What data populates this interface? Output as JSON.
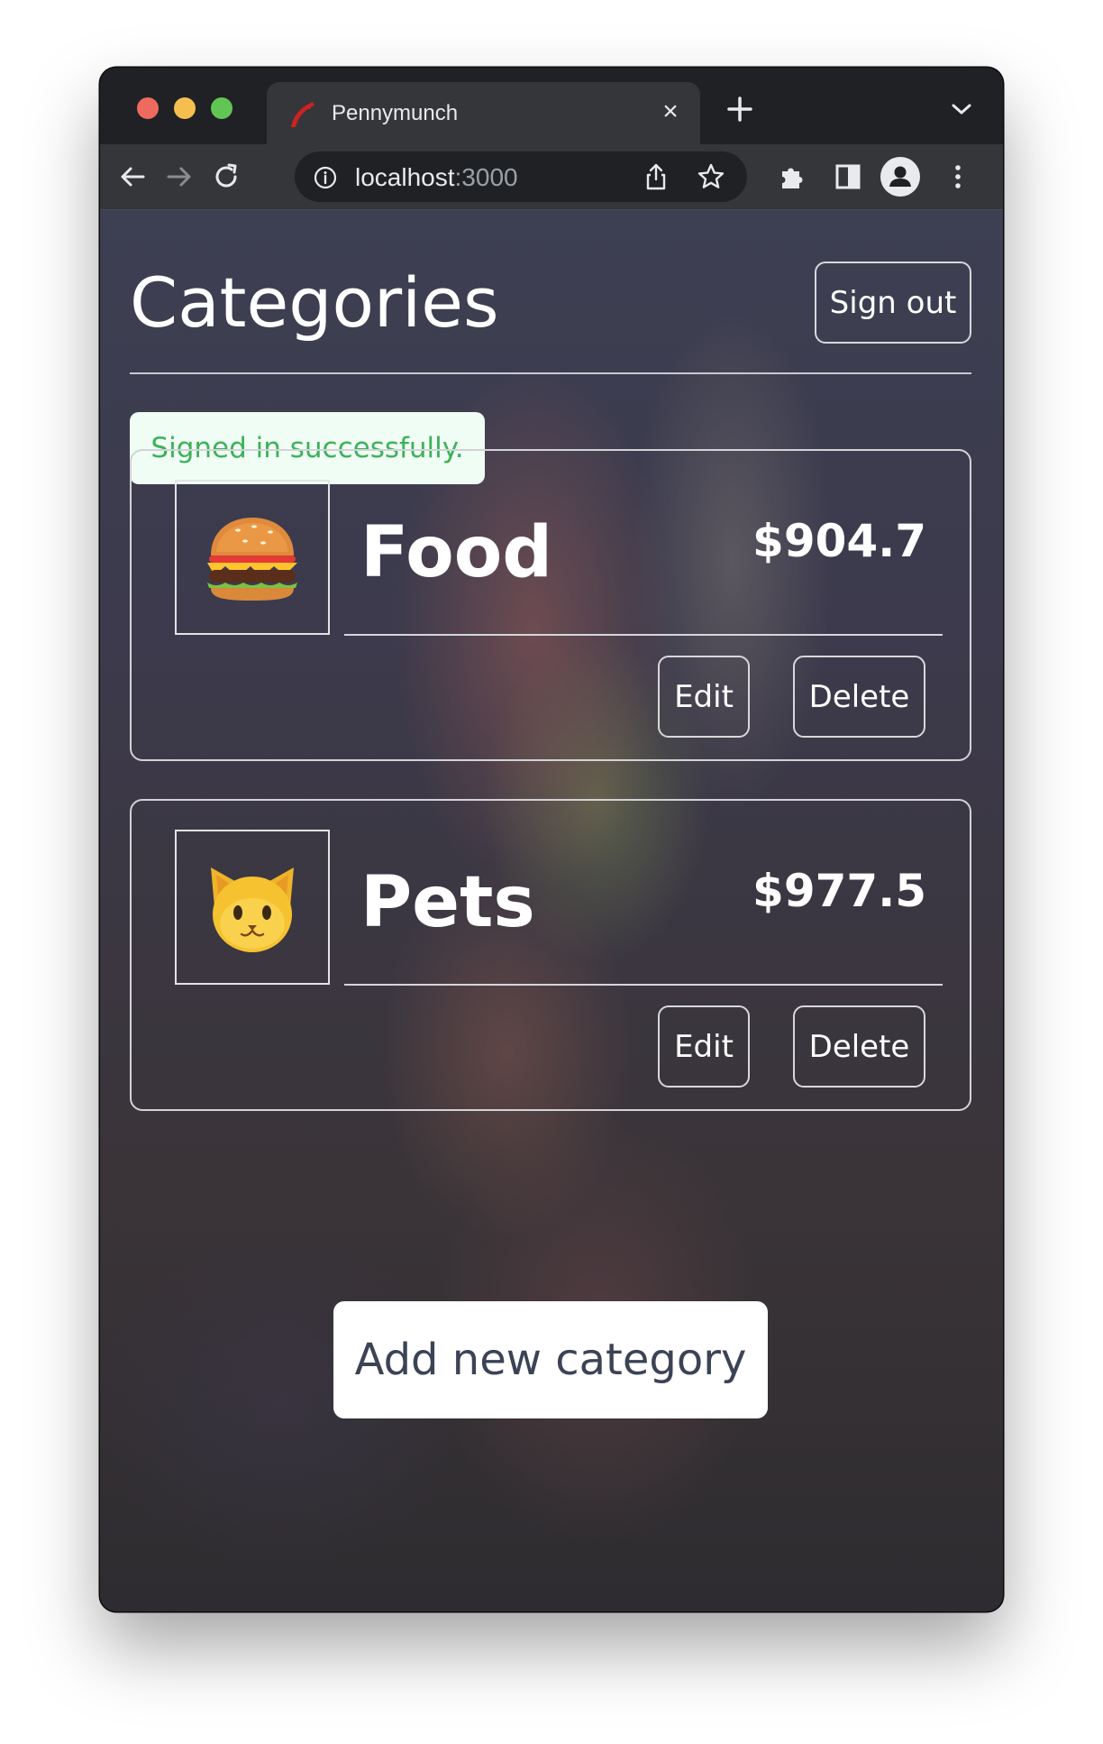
{
  "browser": {
    "tab_title": "Pennymunch",
    "url_host": "localhost",
    "url_port": ":3000"
  },
  "page": {
    "title": "Categories",
    "sign_out_label": "Sign out",
    "flash_message": "Signed in successfully.",
    "add_button_label": "Add new category"
  },
  "categories": [
    {
      "icon": "🍔",
      "name": "Food",
      "amount": "$904.7",
      "edit_label": "Edit",
      "delete_label": "Delete"
    },
    {
      "icon": "🐱",
      "name": "Pets",
      "amount": "$977.5",
      "edit_label": "Edit",
      "delete_label": "Delete"
    }
  ],
  "colors": {
    "flash_text": "#3cb25a",
    "flash_bg": "#f0fdf4",
    "traffic_red": "#ed6a5e",
    "traffic_yellow": "#f5bf4f",
    "traffic_green": "#61c554"
  }
}
